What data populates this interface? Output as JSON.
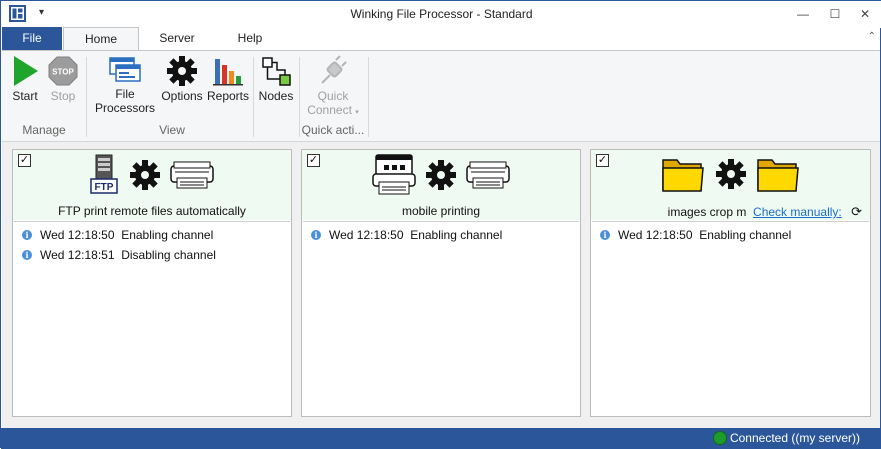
{
  "window": {
    "title": "Winking File Processor - Standard",
    "minimize": "—",
    "maximize": "☐",
    "close": "✕",
    "qat_dropdown": "▾"
  },
  "tabs": {
    "file": "File",
    "home": "Home",
    "server": "Server",
    "help": "Help",
    "collapse": "⌃"
  },
  "ribbon": {
    "manage": {
      "label": "Manage",
      "start": "Start",
      "stop": "Stop",
      "stop_sign_text": "STOP"
    },
    "view": {
      "label": "View",
      "file_processors_1": "File",
      "file_processors_2": "Processors",
      "options": "Options",
      "reports": "Reports",
      "nodes": "Nodes"
    },
    "quick_actions": {
      "label": "Quick acti...",
      "quick_connect_1": "Quick",
      "quick_connect_2": "Connect",
      "dropdown": "▾"
    }
  },
  "panels": [
    {
      "checked": "✓",
      "icon_badge": "FTP",
      "title": "FTP print remote files automatically",
      "log": [
        {
          "time": "Wed 12:18:50",
          "message": "Enabling channel"
        },
        {
          "time": "Wed 12:18:51",
          "message": "Disabling channel"
        }
      ]
    },
    {
      "checked": "✓",
      "title": "mobile printing",
      "log": [
        {
          "time": "Wed 12:18:50",
          "message": "Enabling channel"
        }
      ]
    },
    {
      "checked": "✓",
      "title": "images crop m",
      "check_link": "Check manually:",
      "refresh": "⟳",
      "log": [
        {
          "time": "Wed 12:18:50",
          "message": "Enabling channel"
        }
      ]
    }
  ],
  "status": {
    "text": "Connected ((my server))",
    "color": "#1d9b2b"
  },
  "colors": {
    "accent": "#2b579a",
    "panel_header": "#effaf3",
    "link": "#1a6dc9",
    "start_green": "#1fa52b",
    "folder_yellow": "#ffd800"
  }
}
